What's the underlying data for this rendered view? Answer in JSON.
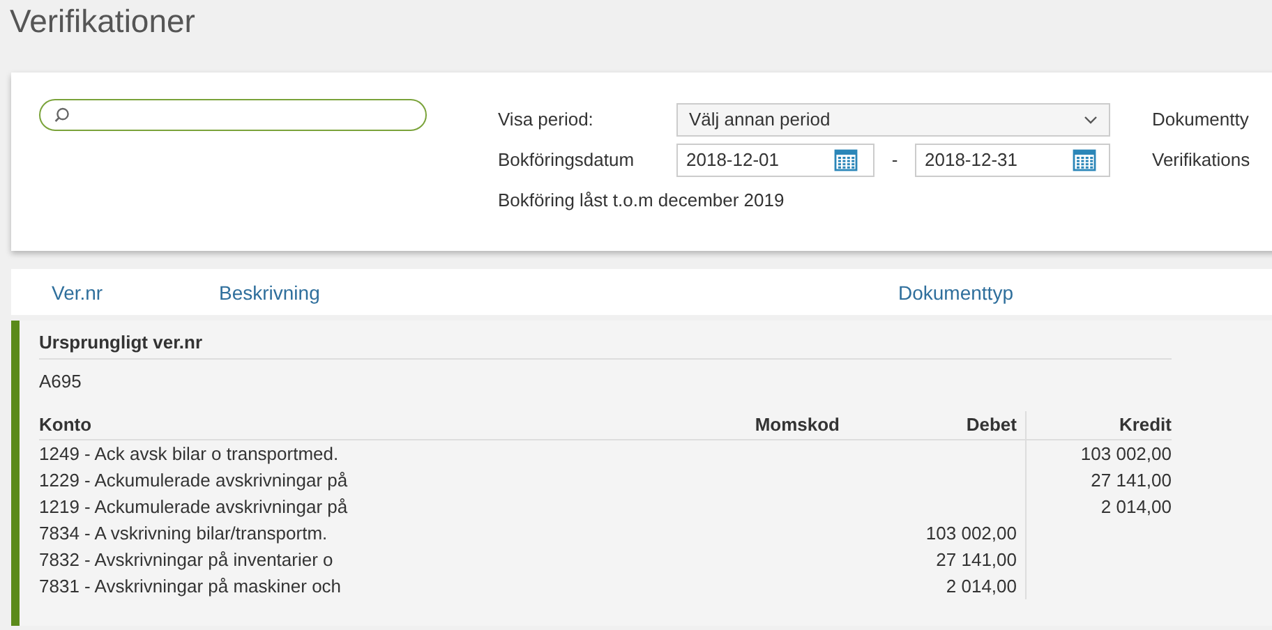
{
  "page_title": "Verifikationer",
  "filters": {
    "period_label": "Visa period:",
    "period_value": "Välj annan period",
    "date_label": "Bokföringsdatum",
    "date_from": "2018-12-01",
    "date_separator": "-",
    "date_to": "2018-12-31",
    "lock_note": "Bokföring låst t.o.m december 2019",
    "right_labels": [
      "Dokumentty",
      "Verifikations"
    ]
  },
  "list_columns": [
    "Ver.nr",
    "Beskrivning",
    "Dokumenttyp"
  ],
  "detail": {
    "original_label": "Ursprungligt ver.nr",
    "original_value": "A695",
    "columns": [
      "Konto",
      "Momskod",
      "Debet",
      "Kredit"
    ],
    "rows": [
      {
        "konto": "1249 - Ack avsk bilar o transportmed.",
        "kredit": "103 002,00"
      },
      {
        "konto": "1229 - Ackumulerade avskrivningar på",
        "kredit": "27 141,00"
      },
      {
        "konto": "1219 - Ackumulerade avskrivningar på",
        "kredit": "2 014,00"
      },
      {
        "konto": "7834 - A vskrivning bilar/transportm.",
        "debet": "103 002,00"
      },
      {
        "konto": "7832 - Avskrivningar på inventarier o",
        "debet": "27 141,00"
      },
      {
        "konto": "7831 - Avskrivningar på maskiner och",
        "debet": "2 014,00"
      }
    ]
  }
}
